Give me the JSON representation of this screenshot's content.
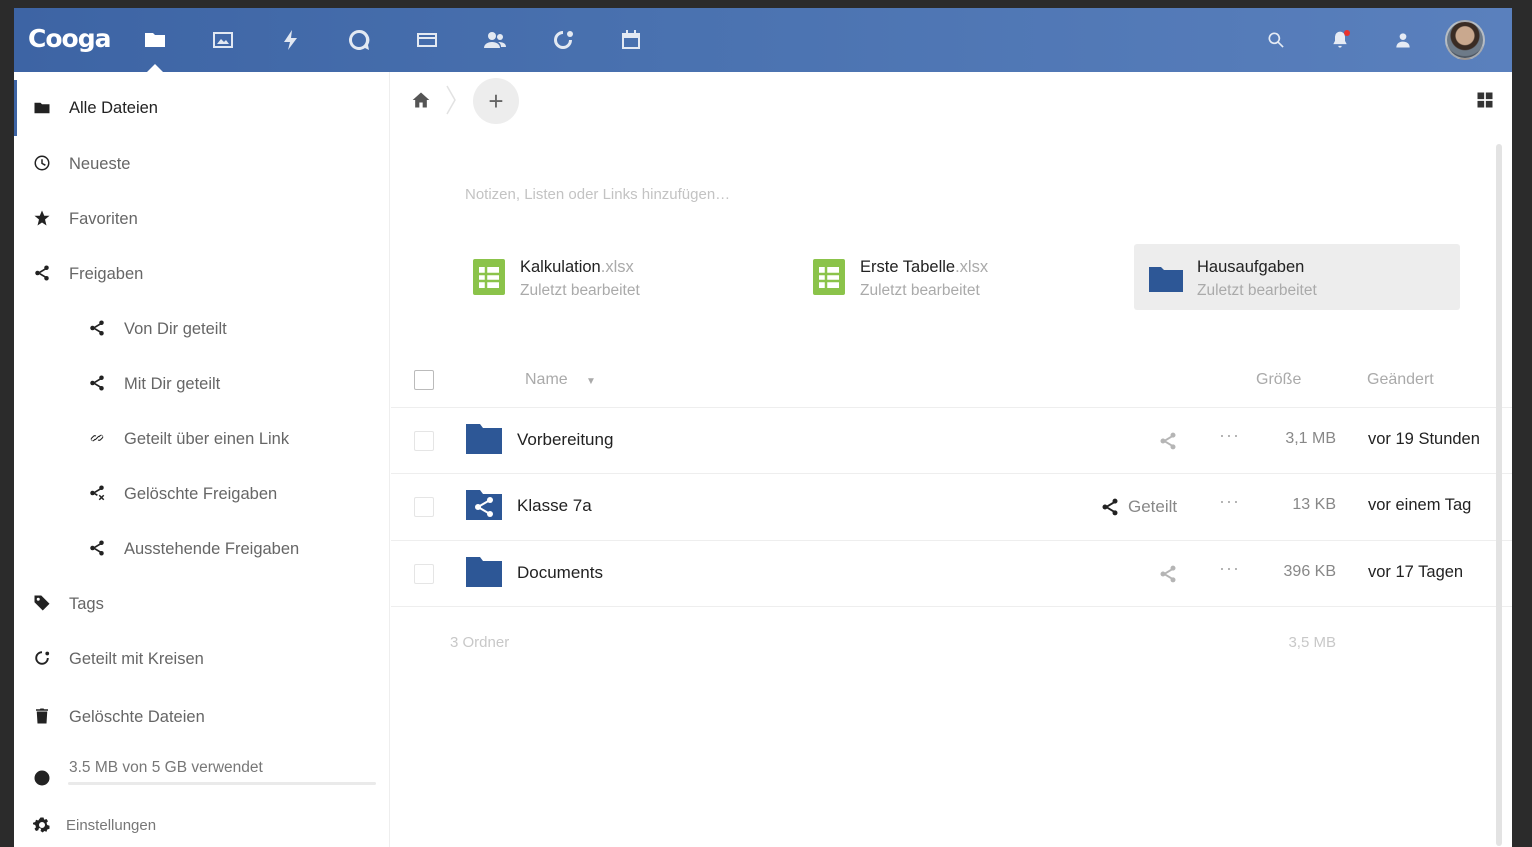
{
  "header": {
    "logo": "Cooga",
    "apps": [
      {
        "name": "files-icon",
        "active": true
      },
      {
        "name": "photos-icon"
      },
      {
        "name": "activity-icon"
      },
      {
        "name": "talk-icon"
      },
      {
        "name": "mail-icon"
      },
      {
        "name": "contacts-icon"
      },
      {
        "name": "circles-icon"
      },
      {
        "name": "calendar-icon"
      }
    ],
    "right_icons": [
      "search-icon",
      "notifications-icon",
      "contacts-menu-icon"
    ],
    "avatar": "user-avatar"
  },
  "sidebar": {
    "items": [
      {
        "label": "Alle Dateien",
        "icon": "folder-icon",
        "active": true
      },
      {
        "label": "Neueste",
        "icon": "clock-icon"
      },
      {
        "label": "Favoriten",
        "icon": "star-icon"
      },
      {
        "label": "Freigaben",
        "icon": "share-icon"
      },
      {
        "label": "Von Dir geteilt",
        "icon": "share-icon",
        "sub": true
      },
      {
        "label": "Mit Dir geteilt",
        "icon": "share-icon",
        "sub": true
      },
      {
        "label": "Geteilt über einen Link",
        "icon": "link-icon",
        "sub": true
      },
      {
        "label": "Gelöschte Freigaben",
        "icon": "deleted-share-icon",
        "sub": true
      },
      {
        "label": "Ausstehende Freigaben",
        "icon": "share-icon",
        "sub": true
      },
      {
        "label": "Tags",
        "icon": "tag-icon"
      },
      {
        "label": "Geteilt mit Kreisen",
        "icon": "circles-icon"
      },
      {
        "label": "Gelöschte Dateien",
        "icon": "trash-icon"
      }
    ],
    "quota": {
      "label": "3.5 MB von 5 GB verwendet",
      "used_fraction": 0.0007
    },
    "settings_label": "Einstellungen"
  },
  "content": {
    "notes_placeholder": "Notizen, Listen oder Links hinzufügen…",
    "recent": [
      {
        "name": "Kalkulation",
        "ext": ".xlsx",
        "sub": "Zuletzt bearbeitet",
        "type": "spreadsheet"
      },
      {
        "name": "Erste Tabelle",
        "ext": ".xlsx",
        "sub": "Zuletzt bearbeitet",
        "type": "spreadsheet"
      },
      {
        "name": "Hausaufgaben",
        "ext": "",
        "sub": "Zuletzt bearbeitet",
        "type": "folder",
        "highlighted": true
      }
    ],
    "table": {
      "col_name": "Name",
      "col_size": "Größe",
      "col_modified": "Geändert"
    },
    "files": [
      {
        "name": "Vorbereitung",
        "type": "folder",
        "shared": false,
        "share_label": "",
        "size": "3,1 MB",
        "modified": "vor 19 Stunden"
      },
      {
        "name": "Klasse 7a",
        "type": "shared-folder",
        "shared": true,
        "share_label": "Geteilt",
        "size": "13 KB",
        "modified": "vor einem Tag"
      },
      {
        "name": "Documents",
        "type": "folder",
        "shared": false,
        "share_label": "",
        "size": "396 KB",
        "modified": "vor 17 Tagen"
      }
    ],
    "summary": {
      "count": "3 Ordner",
      "size": "3,5 MB"
    }
  },
  "colors": {
    "header": "#3d64a4",
    "folder": "#2d5796",
    "spreadsheet": "#8bc34a"
  }
}
